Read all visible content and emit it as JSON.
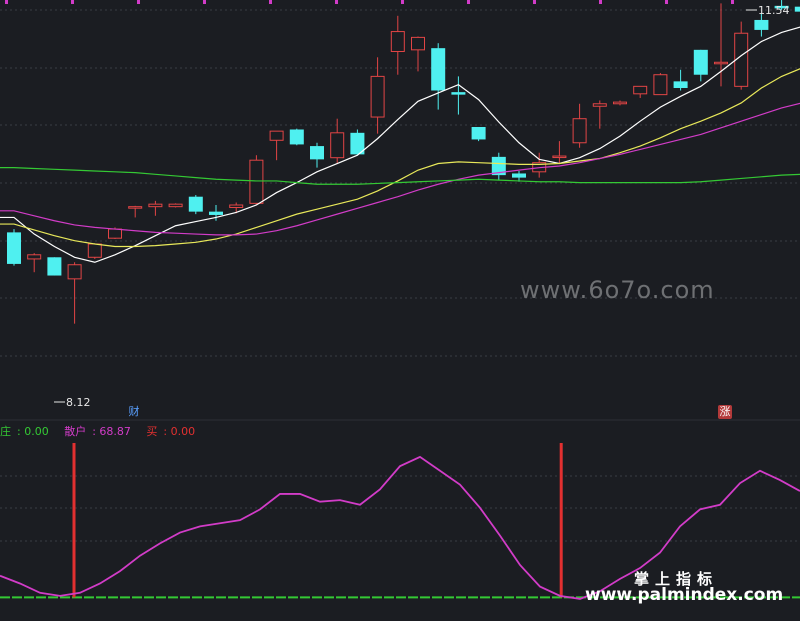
{
  "chart_data": [
    {
      "type": "candlestick",
      "title": "",
      "ylim": [
        7.2,
        11.9
      ],
      "grid": true,
      "candles": [
        {
          "o": 9.22,
          "h": 9.26,
          "l": 8.82,
          "c": 8.84
        },
        {
          "o": 8.9,
          "h": 8.97,
          "l": 8.74,
          "c": 8.95
        },
        {
          "o": 8.92,
          "h": 8.92,
          "l": 8.7,
          "c": 8.7
        },
        {
          "o": 8.66,
          "h": 8.86,
          "l": 8.12,
          "c": 8.83
        },
        {
          "o": 8.92,
          "h": 9.09,
          "l": 8.9,
          "c": 9.08
        },
        {
          "o": 9.15,
          "h": 9.28,
          "l": 9.14,
          "c": 9.26
        },
        {
          "o": 9.53,
          "h": 9.54,
          "l": 9.4,
          "c": 9.53
        },
        {
          "o": 9.53,
          "h": 9.6,
          "l": 9.42,
          "c": 9.56
        },
        {
          "o": 9.53,
          "h": 9.57,
          "l": 9.52,
          "c": 9.56
        },
        {
          "o": 9.65,
          "h": 9.67,
          "l": 9.44,
          "c": 9.47
        },
        {
          "o": 9.47,
          "h": 9.55,
          "l": 9.36,
          "c": 9.43
        },
        {
          "o": 9.52,
          "h": 9.58,
          "l": 9.45,
          "c": 9.55
        },
        {
          "o": 9.57,
          "h": 10.15,
          "l": 9.56,
          "c": 10.09
        },
        {
          "o": 10.33,
          "h": 10.43,
          "l": 10.09,
          "c": 10.44
        },
        {
          "o": 10.46,
          "h": 10.47,
          "l": 10.27,
          "c": 10.28
        },
        {
          "o": 10.26,
          "h": 10.3,
          "l": 10.0,
          "c": 10.1
        },
        {
          "o": 10.12,
          "h": 10.59,
          "l": 10.05,
          "c": 10.42
        },
        {
          "o": 10.42,
          "h": 10.46,
          "l": 10.16,
          "c": 10.16
        },
        {
          "o": 10.61,
          "h": 11.33,
          "l": 10.41,
          "c": 11.1
        },
        {
          "o": 11.4,
          "h": 11.83,
          "l": 11.12,
          "c": 11.64
        },
        {
          "o": 11.42,
          "h": 11.58,
          "l": 11.16,
          "c": 11.57
        },
        {
          "o": 11.44,
          "h": 11.5,
          "l": 10.7,
          "c": 10.93
        },
        {
          "o": 10.91,
          "h": 11.1,
          "l": 10.64,
          "c": 10.88
        },
        {
          "o": 10.49,
          "h": 10.49,
          "l": 10.32,
          "c": 10.34
        },
        {
          "o": 10.13,
          "h": 10.18,
          "l": 9.85,
          "c": 9.91
        },
        {
          "o": 9.93,
          "h": 9.96,
          "l": 9.83,
          "c": 9.88
        },
        {
          "o": 9.95,
          "h": 10.18,
          "l": 9.88,
          "c": 10.06
        },
        {
          "o": 10.14,
          "h": 10.32,
          "l": 10.05,
          "c": 10.14
        },
        {
          "o": 10.3,
          "h": 10.77,
          "l": 10.24,
          "c": 10.59
        },
        {
          "o": 10.74,
          "h": 10.81,
          "l": 10.47,
          "c": 10.77
        },
        {
          "o": 10.77,
          "h": 10.81,
          "l": 10.75,
          "c": 10.79
        },
        {
          "o": 10.89,
          "h": 10.92,
          "l": 10.84,
          "c": 10.98
        },
        {
          "o": 10.88,
          "h": 11.14,
          "l": 10.88,
          "c": 11.12
        },
        {
          "o": 11.04,
          "h": 11.18,
          "l": 10.93,
          "c": 10.96
        },
        {
          "o": 11.42,
          "h": 11.42,
          "l": 11.04,
          "c": 11.12
        },
        {
          "o": 11.27,
          "h": 11.98,
          "l": 10.98,
          "c": 11.27
        },
        {
          "o": 10.98,
          "h": 11.76,
          "l": 10.94,
          "c": 11.62
        },
        {
          "o": 11.78,
          "h": 11.86,
          "l": 11.58,
          "c": 11.66
        },
        {
          "o": 11.95,
          "h": 12.02,
          "l": 11.9,
          "c": 11.92
        },
        {
          "o": 11.94,
          "h": 11.94,
          "l": 11.86,
          "c": 11.88
        }
      ],
      "ma_lines": [
        {
          "color": "#ffffff",
          "values": [
            9.4,
            9.2,
            9.05,
            8.92,
            8.86,
            8.95,
            9.06,
            9.18,
            9.3,
            9.35,
            9.4,
            9.46,
            9.55,
            9.7,
            9.82,
            9.95,
            10.05,
            10.15,
            10.35,
            10.58,
            10.8,
            10.9,
            11.0,
            10.82,
            10.55,
            10.3,
            10.1,
            10.05,
            10.12,
            10.23,
            10.38,
            10.56,
            10.73,
            10.86,
            10.98,
            11.16,
            11.35,
            11.52,
            11.63,
            11.7
          ]
        },
        {
          "color": "#e8e85a",
          "values": [
            9.32,
            9.25,
            9.18,
            9.12,
            9.08,
            9.05,
            9.05,
            9.06,
            9.08,
            9.1,
            9.14,
            9.2,
            9.28,
            9.36,
            9.44,
            9.5,
            9.56,
            9.62,
            9.72,
            9.84,
            9.97,
            10.05,
            10.07,
            10.06,
            10.05,
            10.04,
            10.04,
            10.05,
            10.08,
            10.11,
            10.18,
            10.26,
            10.36,
            10.47,
            10.56,
            10.66,
            10.78,
            10.96,
            11.1,
            11.2
          ]
        },
        {
          "color": "#d23cc8",
          "values": [
            9.48,
            9.42,
            9.36,
            9.31,
            9.28,
            9.26,
            9.24,
            9.22,
            9.21,
            9.2,
            9.19,
            9.19,
            9.2,
            9.24,
            9.3,
            9.37,
            9.44,
            9.51,
            9.58,
            9.65,
            9.73,
            9.8,
            9.86,
            9.91,
            9.94,
            9.97,
            10.0,
            10.02,
            10.06,
            10.11,
            10.16,
            10.22,
            10.28,
            10.34,
            10.4,
            10.48,
            10.56,
            10.64,
            10.72,
            10.78
          ]
        },
        {
          "color": "#34c934",
          "values": [
            10.0,
            9.99,
            9.98,
            9.97,
            9.96,
            9.95,
            9.94,
            9.92,
            9.9,
            9.88,
            9.86,
            9.85,
            9.84,
            9.84,
            9.82,
            9.8,
            9.8,
            9.8,
            9.81,
            9.82,
            9.83,
            9.84,
            9.85,
            9.86,
            9.85,
            9.84,
            9.83,
            9.83,
            9.82,
            9.82,
            9.82,
            9.82,
            9.82,
            9.82,
            9.83,
            9.85,
            9.87,
            9.89,
            9.91,
            9.92
          ]
        }
      ],
      "annotations": {
        "high_label": "11.54",
        "low_label": "8.12"
      },
      "event_badges": [
        "财",
        "涨"
      ]
    },
    {
      "type": "line",
      "title": "",
      "ylim": [
        -14,
        100
      ],
      "grid": true,
      "legend": [
        {
          "label": "庄",
          "value": "0.00",
          "color": "#34c934"
        },
        {
          "label": "散户",
          "value": "68.87",
          "color": "#d23cc8"
        },
        {
          "label": "买",
          "value": "0.00",
          "color": "#e23030"
        }
      ],
      "series": [
        {
          "name": "散户",
          "color": "#d23cc8",
          "values": [
            14,
            9,
            3,
            1,
            3,
            9,
            17,
            27,
            35,
            42,
            46,
            48,
            50,
            57,
            67,
            67,
            62,
            63,
            60,
            70,
            85,
            91,
            82,
            73,
            58,
            40,
            21,
            7,
            1,
            -1,
            4,
            12,
            19,
            29,
            46,
            57,
            60,
            74,
            82,
            76,
            68.87
          ]
        },
        {
          "name": "庄",
          "color": "#34c934",
          "values": [
            0,
            0
          ]
        },
        {
          "name": "买",
          "color": "#e23030",
          "spikes": [
            {
              "index": 3,
              "value": 100
            },
            {
              "index": 27,
              "value": 100
            }
          ]
        }
      ]
    }
  ],
  "watermarks": {
    "mid": "www.6o7o.com",
    "cn": "掌上指标",
    "url": "www.palmindex.com"
  },
  "badges": {
    "cai": "财",
    "zhang": "涨"
  }
}
